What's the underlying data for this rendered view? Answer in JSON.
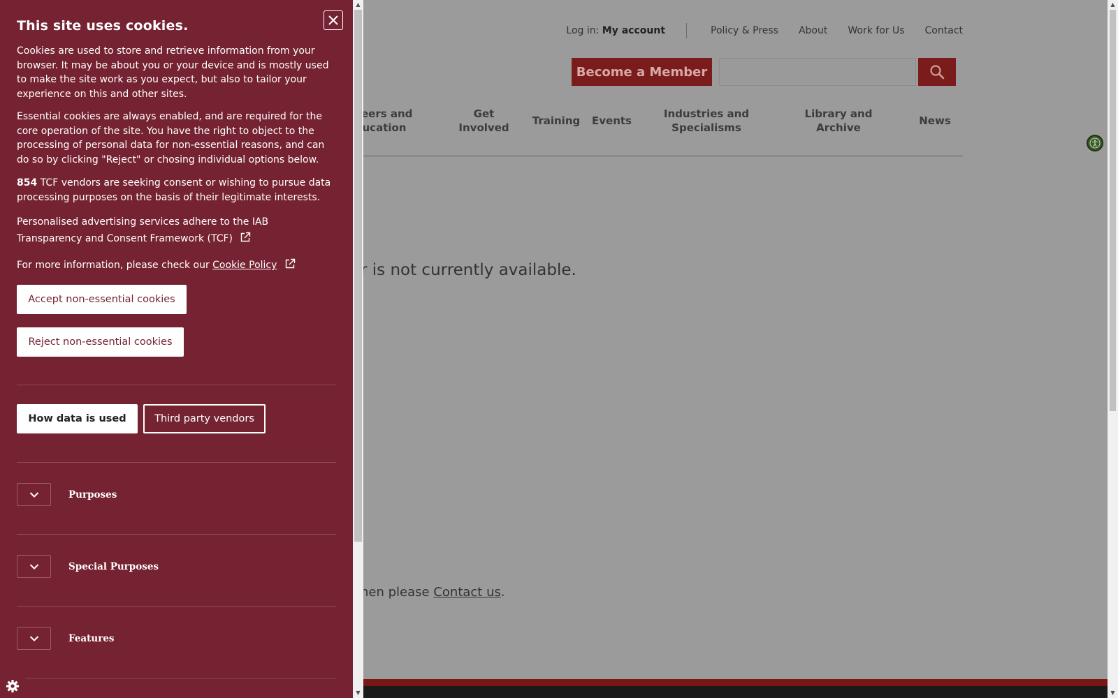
{
  "site": {
    "topnav": {
      "login_label": "Log in:",
      "my_account": "My account",
      "links": [
        "Policy & Press",
        "About",
        "Work for Us",
        "Contact"
      ]
    },
    "member_button": "Become a Member",
    "search_placeholder": "",
    "mainnav": [
      "reers and\nucation",
      "Get\nInvolved",
      "Training",
      "Events",
      "Industries and\nSpecialisms",
      "Library and\nArchive",
      "News"
    ],
    "unavailable_text": "r is not currently available.",
    "contact_prefix": "hen please ",
    "contact_link": "Contact us",
    "contact_suffix": "."
  },
  "cookie_panel": {
    "title": "This site uses cookies.",
    "para1": "Cookies are used to store and retrieve information from your browser. It may be about you or your device and is mostly used to make the site work as you expect, but also to tailor your experience on this and other sites.",
    "para2": "Essential cookies are always enabled, and are required for the core operation of the site. You have the right to object to the processing of personal data for non-essential reasons, and can do so by clicking \"Reject\" or chosing individual options below.",
    "vendor_count": "854",
    "para3_rest": " TCF vendors are seeking consent or wishing to pursue data processing purposes on the basis of their legitimate interests.",
    "para4": "Personalised advertising services adhere to the IAB Transparency and Consent Framework (TCF)",
    "para5_prefix": "For more information, please check our ",
    "cookie_policy_link": "Cookie Policy",
    "accept_button": "Accept non-essential cookies",
    "reject_button": "Reject non-essential cookies",
    "tab_how_data": "How data is used",
    "tab_vendors": "Third party vendors",
    "sections": [
      "Purposes",
      "Special Purposes",
      "Features"
    ]
  },
  "colors": {
    "panel_bg": "#752232",
    "brand_red": "#7a1c1c",
    "overlay_gray": "#9b9b9b"
  },
  "icons": [
    "close-icon",
    "external-link-icon",
    "chevron-down-icon",
    "search-icon",
    "accessibility-icon",
    "gear-icon"
  ]
}
